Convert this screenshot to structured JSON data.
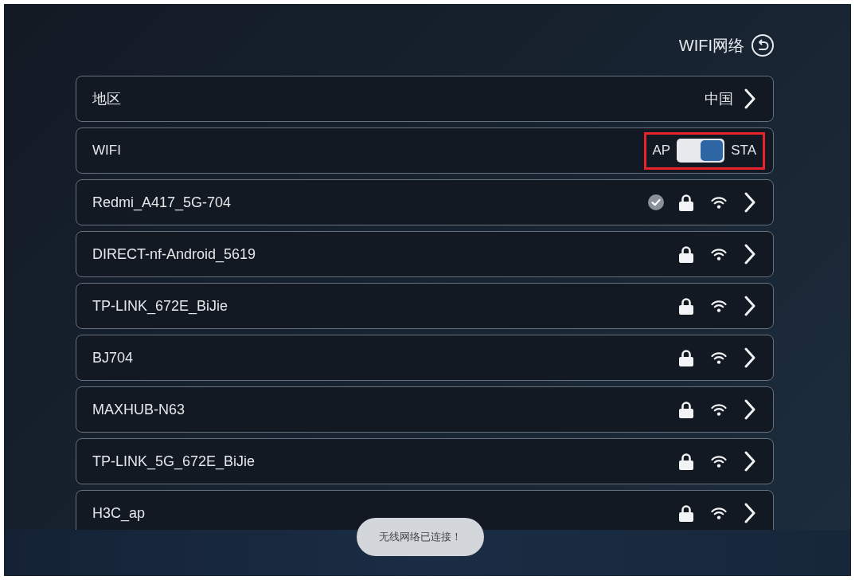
{
  "header": {
    "title": "WIFI网络"
  },
  "region": {
    "label": "地区",
    "value": "中国"
  },
  "wifi": {
    "label": "WIFI",
    "left_option": "AP",
    "right_option": "STA",
    "on": true,
    "highlighted": true
  },
  "networks": [
    {
      "ssid": "Redmi_A417_5G-704",
      "connected": true,
      "secured": true
    },
    {
      "ssid": "DIRECT-nf-Android_5619",
      "connected": false,
      "secured": true
    },
    {
      "ssid": "TP-LINK_672E_BiJie",
      "connected": false,
      "secured": true
    },
    {
      "ssid": "BJ704",
      "connected": false,
      "secured": true
    },
    {
      "ssid": "MAXHUB-N63",
      "connected": false,
      "secured": true
    },
    {
      "ssid": "TP-LINK_5G_672E_BiJie",
      "connected": false,
      "secured": true
    },
    {
      "ssid": "H3C_ap",
      "connected": false,
      "secured": true
    }
  ],
  "toast": {
    "text": "无线网络已连接！"
  }
}
